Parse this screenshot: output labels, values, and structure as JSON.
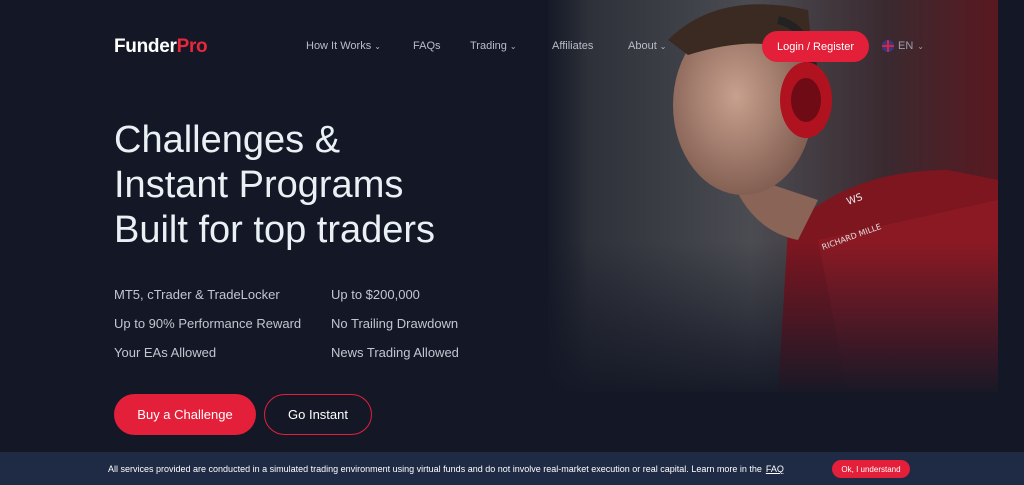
{
  "colors": {
    "background": "#141826",
    "accent": "#e31f39",
    "cookie_bar": "#1f2a45"
  },
  "header": {
    "logo_part1": "Funder",
    "logo_part2": "Pro",
    "nav": [
      {
        "label": "How It Works",
        "has_dropdown": true
      },
      {
        "label": "FAQs",
        "has_dropdown": false
      },
      {
        "label": "Trading",
        "has_dropdown": true
      },
      {
        "label": "Affiliates",
        "has_dropdown": false
      },
      {
        "label": "About",
        "has_dropdown": true
      }
    ],
    "login_label": "Login / Register",
    "language": "EN"
  },
  "hero": {
    "title_lines": [
      "Challenges &",
      "Instant Programs",
      "Built for top traders"
    ],
    "features": [
      "MT5, cTrader & TradeLocker",
      "Up to $200,000",
      "Up to 90% Performance Reward",
      "No Trailing Drawdown",
      "Your EAs Allowed",
      "News Trading Allowed"
    ],
    "primary_button": "Buy a Challenge",
    "secondary_button": "Go Instant"
  },
  "cookie_bar": {
    "text": "All services provided are conducted in a simulated trading environment using virtual funds and do not involve real-market execution or real capital. Learn more in the",
    "link": "FAQ",
    "button": "Ok, I understand"
  }
}
